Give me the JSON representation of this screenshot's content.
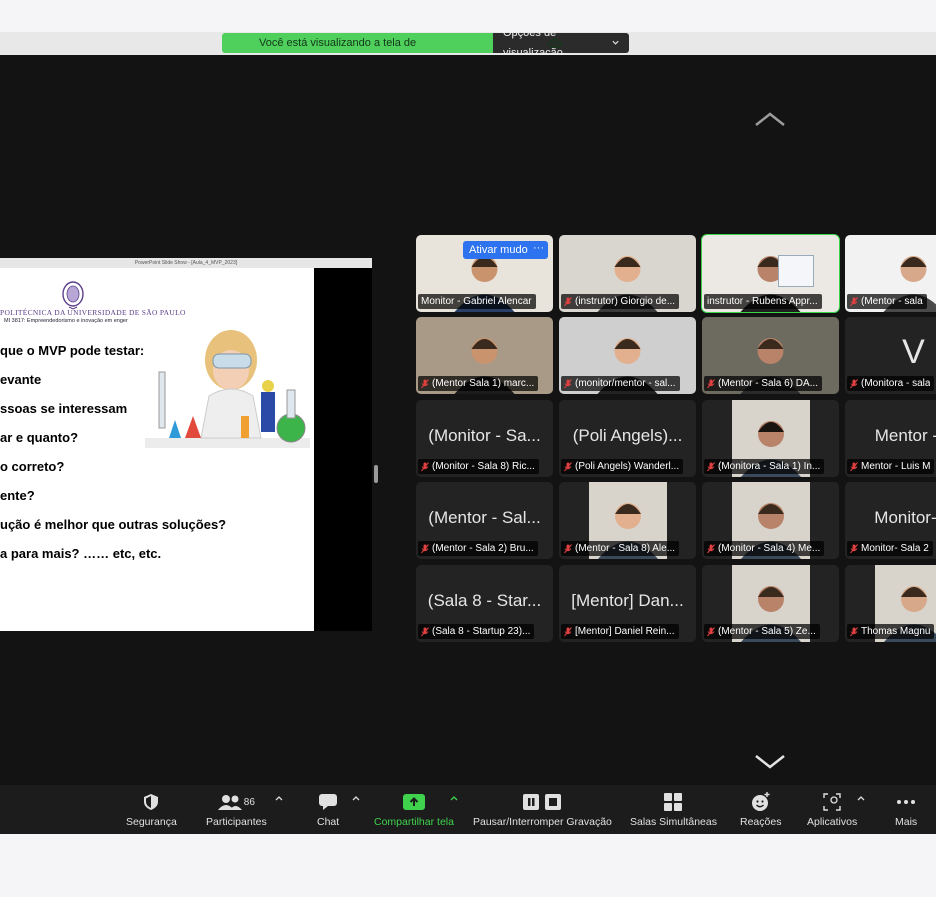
{
  "banner": {
    "text": "Você está visualizando a tela de instrutor - Ruben...",
    "options_label": "Opções de visualização"
  },
  "slide": {
    "titlebar": "PowerPoint Slide Show - [Aula_4_MVP_2023]",
    "institution": "POLITÉCNICA DA UNIVERSIDADE DE SÃO PAULO",
    "course": "MI 3817: Empreendedorismo e inovação em enger",
    "lines": [
      "que o MVP pode testar:",
      "evante",
      "ssoas se interessam",
      "ar e quanto?",
      "o correto?",
      "ente?",
      "ução é melhor que outras soluções?",
      "a para mais? ……    etc, etc."
    ]
  },
  "tile_controls": {
    "unmute_label": "Ativar mudo",
    "more_label": "···"
  },
  "participants": [
    {
      "caption": "Monitor - Gabriel Alencar",
      "big": "",
      "muted": false
    },
    {
      "caption": "(instrutor) Giorgio de...",
      "big": "",
      "muted": true
    },
    {
      "caption": "instrutor - Rubens Appr...",
      "big": "",
      "muted": false
    },
    {
      "caption": "(Mentor - sala",
      "big": "",
      "muted": true
    },
    {
      "caption": "(Mentor Sala 1) marc...",
      "big": "",
      "muted": true
    },
    {
      "caption": "(monitor/mentor - sal...",
      "big": "",
      "muted": true
    },
    {
      "caption": "(Mentor - Sala 6) DA...",
      "big": "",
      "muted": true
    },
    {
      "caption": "(Monitora - sala",
      "big": "V",
      "muted": true
    },
    {
      "caption": "(Monitor - Sala 8) Ric...",
      "big": "(Monitor - Sa...",
      "muted": true
    },
    {
      "caption": "(Poli Angels) Wanderl...",
      "big": "(Poli Angels)...",
      "muted": true
    },
    {
      "caption": "(Monitora - Sala 1) In...",
      "big": "",
      "muted": true
    },
    {
      "caption": "Mentor - Luis M",
      "big": "Mentor - L",
      "muted": true
    },
    {
      "caption": "(Mentor - Sala 2) Bru...",
      "big": "(Mentor - Sal...",
      "muted": true
    },
    {
      "caption": "(Mentor - Sala 8) Ale...",
      "big": "",
      "muted": true
    },
    {
      "caption": "(Monitor - Sala 4) Me...",
      "big": "",
      "muted": true
    },
    {
      "caption": "Monitor- Sala 2",
      "big": "Monitor- S",
      "muted": true
    },
    {
      "caption": "(Sala 8 - Startup 23)...",
      "big": "(Sala 8 - Star...",
      "muted": true
    },
    {
      "caption": "[Mentor] Daniel Rein...",
      "big": "[Mentor] Dan...",
      "muted": true
    },
    {
      "caption": "(Mentor - Sala 5) Ze...",
      "big": "",
      "muted": true
    },
    {
      "caption": "Thomas Magnu",
      "big": "",
      "muted": true
    }
  ],
  "toolbar": {
    "security": "Segurança",
    "participants": "Participantes",
    "participants_count": "86",
    "chat": "Chat",
    "share": "Compartilhar tela",
    "record": "Pausar/Interromper Gravação",
    "breakout": "Salas Simultâneas",
    "reactions": "Reações",
    "apps": "Aplicativos",
    "more": "Mais"
  },
  "colors": {
    "accent_green": "#3fd24d",
    "tile_bg": "#232323",
    "button_blue": "#2d72ee"
  }
}
